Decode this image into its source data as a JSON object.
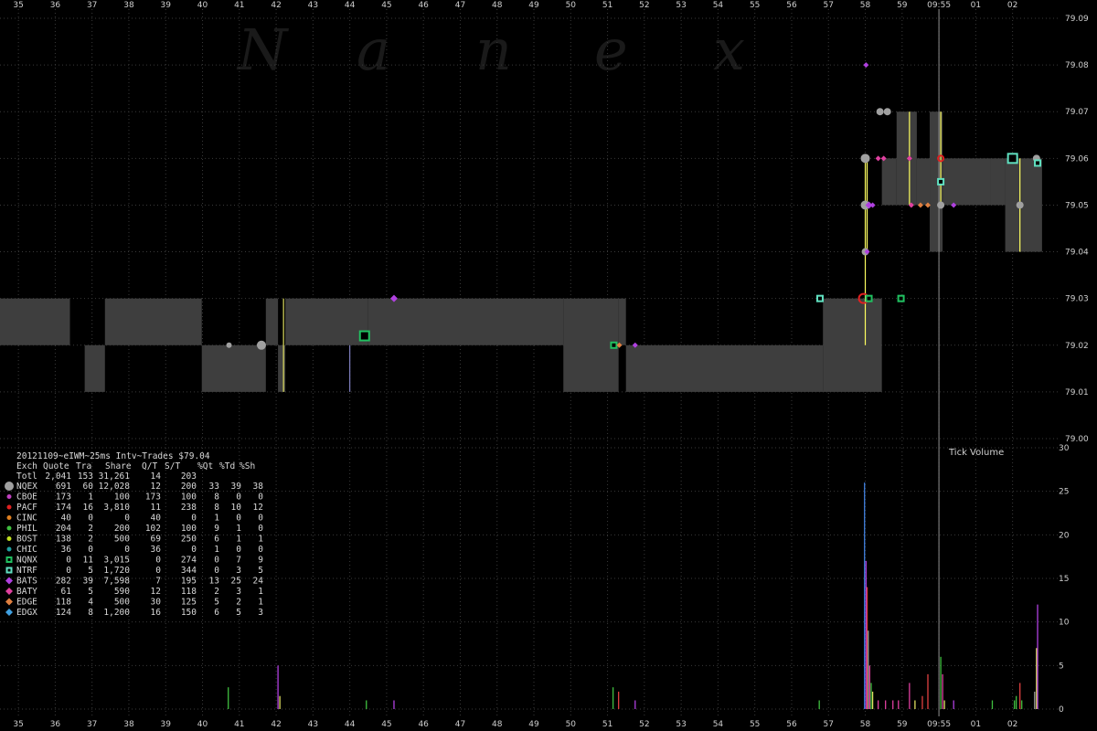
{
  "watermark": [
    "N",
    "a",
    "n",
    "e",
    "x"
  ],
  "table": {
    "title": "20121109~eIWM~25ms Intv~Trades $79.04",
    "headers": [
      "Exch",
      "Quote",
      "Tra",
      "Share",
      "Q/T",
      "S/T",
      "%Qt",
      "%Td",
      "%Sh"
    ],
    "total": {
      "label": "Totl",
      "values": [
        "2,041",
        "153",
        "31,261",
        "14",
        "203",
        "",
        "",
        ""
      ]
    },
    "rows": [
      {
        "exch": "NQEX",
        "color": "#a0a0a0",
        "shape": "big-circle",
        "values": [
          "691",
          "60",
          "12,028",
          "12",
          "200",
          "33",
          "39",
          "38"
        ]
      },
      {
        "exch": "CBOE",
        "color": "#c040c0",
        "shape": "dot",
        "values": [
          "173",
          "1",
          "100",
          "173",
          "100",
          "8",
          "0",
          "0"
        ]
      },
      {
        "exch": "PACF",
        "color": "#e02020",
        "shape": "dot",
        "values": [
          "174",
          "16",
          "3,810",
          "11",
          "238",
          "8",
          "10",
          "12"
        ]
      },
      {
        "exch": "CINC",
        "color": "#e08020",
        "shape": "dot",
        "values": [
          "40",
          "0",
          "0",
          "40",
          "0",
          "1",
          "0",
          "0"
        ]
      },
      {
        "exch": "PHIL",
        "color": "#40c040",
        "shape": "dot",
        "values": [
          "204",
          "2",
          "200",
          "102",
          "100",
          "9",
          "1",
          "0"
        ]
      },
      {
        "exch": "BOST",
        "color": "#c0e020",
        "shape": "dot",
        "values": [
          "138",
          "2",
          "500",
          "69",
          "250",
          "6",
          "1",
          "1"
        ]
      },
      {
        "exch": "CHIC",
        "color": "#20a0a0",
        "shape": "dot",
        "values": [
          "36",
          "0",
          "0",
          "36",
          "0",
          "1",
          "0",
          "0"
        ]
      },
      {
        "exch": "NQNX",
        "color": "#20c060",
        "shape": "square",
        "values": [
          "0",
          "11",
          "3,015",
          "0",
          "274",
          "0",
          "7",
          "9"
        ]
      },
      {
        "exch": "NTRF",
        "color": "#60e0c0",
        "shape": "square",
        "values": [
          "0",
          "5",
          "1,720",
          "0",
          "344",
          "0",
          "3",
          "5"
        ]
      },
      {
        "exch": "BATS",
        "color": "#b040e0",
        "shape": "diamond",
        "values": [
          "282",
          "39",
          "7,598",
          "7",
          "195",
          "13",
          "25",
          "24"
        ]
      },
      {
        "exch": "BATY",
        "color": "#e040a0",
        "shape": "diamond",
        "values": [
          "61",
          "5",
          "590",
          "12",
          "118",
          "2",
          "3",
          "1"
        ]
      },
      {
        "exch": "EDGE",
        "color": "#e08040",
        "shape": "diamond",
        "values": [
          "118",
          "4",
          "500",
          "30",
          "125",
          "5",
          "2",
          "1"
        ]
      },
      {
        "exch": "EDGX",
        "color": "#40a0e0",
        "shape": "diamond",
        "values": [
          "124",
          "8",
          "1,200",
          "16",
          "150",
          "6",
          "5",
          "3"
        ]
      }
    ]
  },
  "chart_data": [
    {
      "type": "scatter",
      "title": "",
      "xlabel": "",
      "ylabel": "",
      "x_tick_labels": [
        "35",
        "36",
        "37",
        "38",
        "39",
        "40",
        "41",
        "42",
        "43",
        "44",
        "45",
        "46",
        "47",
        "48",
        "49",
        "50",
        "51",
        "52",
        "53",
        "54",
        "55",
        "56",
        "57",
        "58",
        "59",
        "09:55",
        "01",
        "02"
      ],
      "y_ticks": [
        "79.00",
        "79.01",
        "79.02",
        "79.03",
        "79.04",
        "79.05",
        "79.06",
        "79.07",
        "79.08",
        "79.09"
      ],
      "ylim": [
        79.0,
        79.09
      ],
      "x_unit": "seconds",
      "xlim": [
        34.5,
        63.3
      ],
      "marker_line_at": 60.0,
      "spread_segments": [
        {
          "x0": 34.5,
          "x1": 36.4,
          "bid": 79.02,
          "ask": 79.03
        },
        {
          "x0": 36.4,
          "x1": 36.8,
          "bid": 79.02,
          "ask": 79.02
        },
        {
          "x0": 36.8,
          "x1": 37.35,
          "bid": 79.01,
          "ask": 79.02
        },
        {
          "x0": 37.35,
          "x1": 39.98,
          "bid": 79.02,
          "ask": 79.03
        },
        {
          "x0": 39.98,
          "x1": 41.72,
          "bid": 79.01,
          "ask": 79.02
        },
        {
          "x0": 41.72,
          "x1": 42.05,
          "bid": 79.02,
          "ask": 79.03
        },
        {
          "x0": 42.05,
          "x1": 42.25,
          "bid": 79.01,
          "ask": 79.02
        },
        {
          "x0": 42.25,
          "x1": 44.5,
          "bid": 79.02,
          "ask": 79.03
        },
        {
          "x0": 44.5,
          "x1": 49.8,
          "bid": 79.02,
          "ask": 79.03
        },
        {
          "x0": 49.8,
          "x1": 51.3,
          "bid": 79.01,
          "ask": 79.03
        },
        {
          "x0": 51.3,
          "x1": 51.5,
          "bid": 79.02,
          "ask": 79.03
        },
        {
          "x0": 51.5,
          "x1": 56.85,
          "bid": 79.01,
          "ask": 79.02
        },
        {
          "x0": 56.85,
          "x1": 58.45,
          "bid": 79.01,
          "ask": 79.03
        },
        {
          "x0": 58.45,
          "x1": 58.85,
          "bid": 79.05,
          "ask": 79.06
        },
        {
          "x0": 58.85,
          "x1": 59.4,
          "bid": 79.05,
          "ask": 79.07
        },
        {
          "x0": 59.4,
          "x1": 59.75,
          "bid": 79.05,
          "ask": 79.06
        },
        {
          "x0": 59.75,
          "x1": 60.1,
          "bid": 79.04,
          "ask": 79.07
        },
        {
          "x0": 60.1,
          "x1": 61.4,
          "bid": 79.05,
          "ask": 79.06
        },
        {
          "x0": 61.4,
          "x1": 61.8,
          "bid": 79.05,
          "ask": 79.06
        },
        {
          "x0": 61.8,
          "x1": 62.25,
          "bid": 79.04,
          "ask": 79.06
        },
        {
          "x0": 62.25,
          "x1": 62.8,
          "bid": 79.04,
          "ask": 79.06
        }
      ],
      "trades": [
        {
          "x": 40.72,
          "y": 79.02,
          "exch": "NQEX",
          "size": 3
        },
        {
          "x": 41.6,
          "y": 79.02,
          "exch": "NQEX",
          "size": 5
        },
        {
          "x": 44.4,
          "y": 79.022,
          "exch": "NQNX",
          "size": 5
        },
        {
          "x": 45.2,
          "y": 79.03,
          "exch": "BATS",
          "size": 4
        },
        {
          "x": 51.17,
          "y": 79.02,
          "exch": "NQNX",
          "size": 3
        },
        {
          "x": 51.32,
          "y": 79.02,
          "exch": "EDGE",
          "size": 3
        },
        {
          "x": 51.75,
          "y": 79.02,
          "exch": "BATS",
          "size": 3
        },
        {
          "x": 56.77,
          "y": 79.03,
          "exch": "NTRF",
          "size": 3
        },
        {
          "x": 57.95,
          "y": 79.03,
          "exch": "PACF",
          "size": 5
        },
        {
          "x": 58.1,
          "y": 79.03,
          "exch": "NQNX",
          "size": 3
        },
        {
          "x": 58.97,
          "y": 79.03,
          "exch": "NQNX",
          "size": 3
        },
        {
          "x": 58.02,
          "y": 79.08,
          "exch": "BATS",
          "size": 3
        },
        {
          "x": 58.0,
          "y": 79.04,
          "exch": "NQEX",
          "size": 4
        },
        {
          "x": 58.05,
          "y": 79.04,
          "exch": "BATS",
          "size": 3
        },
        {
          "x": 58.0,
          "y": 79.05,
          "exch": "NQEX",
          "size": 5
        },
        {
          "x": 58.1,
          "y": 79.05,
          "exch": "BATS",
          "size": 4
        },
        {
          "x": 58.2,
          "y": 79.05,
          "exch": "BATS",
          "size": 3
        },
        {
          "x": 58.0,
          "y": 79.06,
          "exch": "NQEX",
          "size": 5
        },
        {
          "x": 58.35,
          "y": 79.06,
          "exch": "BATY",
          "size": 3
        },
        {
          "x": 58.5,
          "y": 79.06,
          "exch": "BATY",
          "size": 3
        },
        {
          "x": 58.4,
          "y": 79.07,
          "exch": "NQEX",
          "size": 4
        },
        {
          "x": 58.6,
          "y": 79.07,
          "exch": "NQEX",
          "size": 4
        },
        {
          "x": 59.2,
          "y": 79.06,
          "exch": "BATY",
          "size": 3
        },
        {
          "x": 59.25,
          "y": 79.05,
          "exch": "BATY",
          "size": 3
        },
        {
          "x": 59.5,
          "y": 79.05,
          "exch": "EDGE",
          "size": 3
        },
        {
          "x": 59.7,
          "y": 79.05,
          "exch": "EDGE",
          "size": 3
        },
        {
          "x": 60.05,
          "y": 79.06,
          "exch": "PACF",
          "size": 3
        },
        {
          "x": 60.05,
          "y": 79.055,
          "exch": "NTRF",
          "size": 3
        },
        {
          "x": 60.05,
          "y": 79.05,
          "exch": "NQEX",
          "size": 4
        },
        {
          "x": 60.4,
          "y": 79.05,
          "exch": "BATS",
          "size": 3
        },
        {
          "x": 62.0,
          "y": 79.06,
          "exch": "NTRF",
          "size": 5
        },
        {
          "x": 62.2,
          "y": 79.05,
          "exch": "NQEX",
          "size": 4
        },
        {
          "x": 62.65,
          "y": 79.06,
          "exch": "NQEX",
          "size": 4
        },
        {
          "x": 62.68,
          "y": 79.059,
          "exch": "NTRF",
          "size": 3
        }
      ],
      "trade_lines": [
        {
          "x": 42.2,
          "y0": 79.01,
          "y1": 79.03,
          "color": "#e0e060"
        },
        {
          "x": 44.0,
          "y0": 79.01,
          "y1": 79.02,
          "color": "#8080c0"
        },
        {
          "x": 58.0,
          "y0": 79.02,
          "y1": 79.06,
          "color": "#ffff60"
        },
        {
          "x": 58.05,
          "y0": 79.04,
          "y1": 79.06,
          "color": "#ffff60"
        },
        {
          "x": 59.2,
          "y0": 79.05,
          "y1": 79.07,
          "color": "#ffff60"
        },
        {
          "x": 60.05,
          "y0": 79.05,
          "y1": 79.07,
          "color": "#ffff60"
        },
        {
          "x": 62.2,
          "y0": 79.04,
          "y1": 79.06,
          "color": "#ffff60"
        }
      ]
    },
    {
      "type": "bar",
      "title": "Tick Volume",
      "y_ticks": [
        "0",
        "5",
        "10",
        "15",
        "20",
        "25",
        "30"
      ],
      "ylim": [
        0,
        30
      ],
      "bars": [
        {
          "x": 40.7,
          "v": 2.5,
          "color": "#40c040"
        },
        {
          "x": 42.05,
          "v": 5,
          "color": "#b040e0"
        },
        {
          "x": 42.1,
          "v": 1.5,
          "color": "#e0e060"
        },
        {
          "x": 44.45,
          "v": 1,
          "color": "#40c040"
        },
        {
          "x": 45.2,
          "v": 1,
          "color": "#b040e0"
        },
        {
          "x": 51.15,
          "v": 2.5,
          "color": "#40c040"
        },
        {
          "x": 51.3,
          "v": 2,
          "color": "#e04040"
        },
        {
          "x": 51.75,
          "v": 1,
          "color": "#b040e0"
        },
        {
          "x": 56.75,
          "v": 1,
          "color": "#40c040"
        },
        {
          "x": 57.98,
          "v": 26,
          "color": "#4080e0"
        },
        {
          "x": 58.02,
          "v": 17,
          "color": "#b040e0"
        },
        {
          "x": 58.05,
          "v": 14,
          "color": "#e04040"
        },
        {
          "x": 58.08,
          "v": 9,
          "color": "#a0a0a0"
        },
        {
          "x": 58.12,
          "v": 5,
          "color": "#e040a0"
        },
        {
          "x": 58.16,
          "v": 3,
          "color": "#40c040"
        },
        {
          "x": 58.2,
          "v": 2,
          "color": "#e0e060"
        },
        {
          "x": 58.35,
          "v": 1,
          "color": "#e040a0"
        },
        {
          "x": 58.55,
          "v": 1,
          "color": "#e040a0"
        },
        {
          "x": 58.75,
          "v": 1,
          "color": "#e040a0"
        },
        {
          "x": 58.9,
          "v": 1,
          "color": "#e040a0"
        },
        {
          "x": 59.2,
          "v": 3,
          "color": "#e040a0"
        },
        {
          "x": 59.35,
          "v": 1,
          "color": "#e0e060"
        },
        {
          "x": 59.55,
          "v": 1.5,
          "color": "#e04040"
        },
        {
          "x": 59.7,
          "v": 4,
          "color": "#e04040"
        },
        {
          "x": 60.05,
          "v": 6,
          "color": "#40c040"
        },
        {
          "x": 60.1,
          "v": 4,
          "color": "#e040a0"
        },
        {
          "x": 60.15,
          "v": 1,
          "color": "#e0e060"
        },
        {
          "x": 60.4,
          "v": 1,
          "color": "#b040e0"
        },
        {
          "x": 61.45,
          "v": 1,
          "color": "#40c040"
        },
        {
          "x": 62.05,
          "v": 1,
          "color": "#40c040"
        },
        {
          "x": 62.1,
          "v": 1.5,
          "color": "#40c040"
        },
        {
          "x": 62.2,
          "v": 3,
          "color": "#e04040"
        },
        {
          "x": 62.25,
          "v": 1,
          "color": "#40c040"
        },
        {
          "x": 62.6,
          "v": 2,
          "color": "#a0a0a0"
        },
        {
          "x": 62.65,
          "v": 7,
          "color": "#e0e060"
        },
        {
          "x": 62.68,
          "v": 12,
          "color": "#b040e0"
        }
      ]
    }
  ],
  "colors": {
    "spread_fill": "#3e3e3e",
    "grid": "#3a3a3a",
    "marker_line": "#909090",
    "background": "#000000"
  }
}
